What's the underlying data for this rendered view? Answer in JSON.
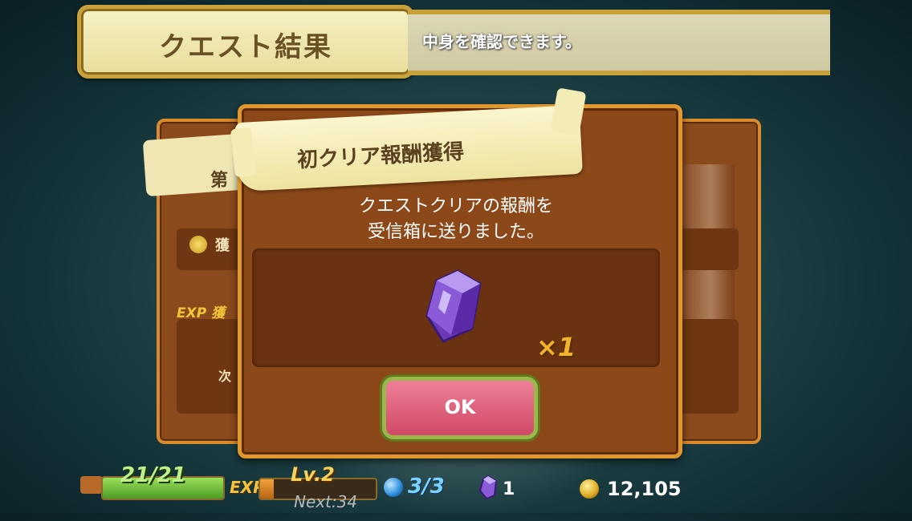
{
  "header": {
    "title": "クエスト結果",
    "info_text": "中身を確認できます。"
  },
  "background_panel": {
    "banner_partial": "第",
    "label_acquired": "獲",
    "exp_label": "EXP 獲",
    "next_partial": "次"
  },
  "dialog": {
    "banner_title": "初クリア報酬獲得",
    "message_line1": "クエストクリアの報酬を",
    "message_line2": "受信箱に送りました。",
    "reward": {
      "icon": "purple-crystal-icon",
      "quantity": "×1"
    },
    "ok_label": "OK"
  },
  "hud": {
    "stamina": "21/21",
    "stamina_fraction": 1.0,
    "exp_label": "EXP",
    "level": "Lv.2",
    "exp_fraction": 0.12,
    "next": "Next:34",
    "orbs": "3/3",
    "gems": "1",
    "coins": "12,105"
  },
  "colors": {
    "dialog_brown": "#8c4818",
    "gold_border": "#e0982e",
    "ok_pink": "#e06880",
    "ok_border_green": "#9bb64a"
  }
}
